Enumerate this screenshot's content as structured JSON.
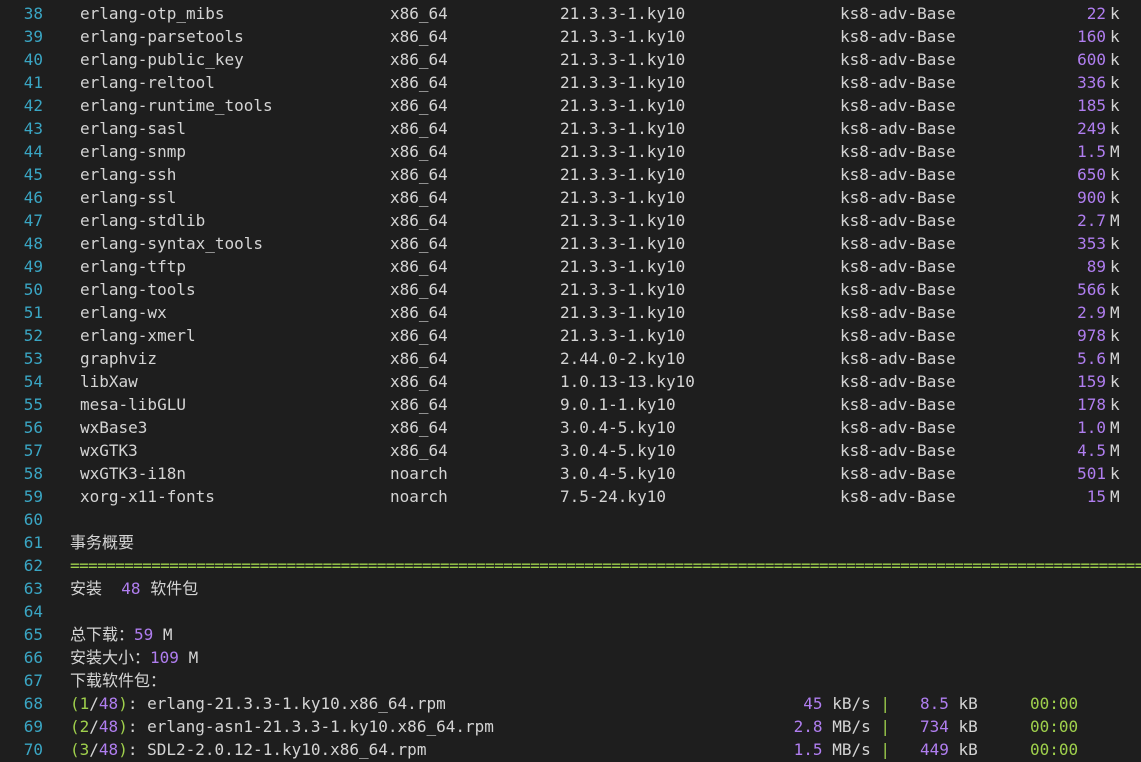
{
  "packages": [
    {
      "line": "38",
      "name": "erlang-otp_mibs",
      "arch": "x86_64",
      "version": "21.3.3-1.ky10",
      "repo": "ks8-adv-Base",
      "size": "22",
      "unit": "k"
    },
    {
      "line": "39",
      "name": "erlang-parsetools",
      "arch": "x86_64",
      "version": "21.3.3-1.ky10",
      "repo": "ks8-adv-Base",
      "size": "160",
      "unit": "k"
    },
    {
      "line": "40",
      "name": "erlang-public_key",
      "arch": "x86_64",
      "version": "21.3.3-1.ky10",
      "repo": "ks8-adv-Base",
      "size": "600",
      "unit": "k"
    },
    {
      "line": "41",
      "name": "erlang-reltool",
      "arch": "x86_64",
      "version": "21.3.3-1.ky10",
      "repo": "ks8-adv-Base",
      "size": "336",
      "unit": "k"
    },
    {
      "line": "42",
      "name": "erlang-runtime_tools",
      "arch": "x86_64",
      "version": "21.3.3-1.ky10",
      "repo": "ks8-adv-Base",
      "size": "185",
      "unit": "k"
    },
    {
      "line": "43",
      "name": "erlang-sasl",
      "arch": "x86_64",
      "version": "21.3.3-1.ky10",
      "repo": "ks8-adv-Base",
      "size": "249",
      "unit": "k"
    },
    {
      "line": "44",
      "name": "erlang-snmp",
      "arch": "x86_64",
      "version": "21.3.3-1.ky10",
      "repo": "ks8-adv-Base",
      "size": "1.5",
      "unit": "M"
    },
    {
      "line": "45",
      "name": "erlang-ssh",
      "arch": "x86_64",
      "version": "21.3.3-1.ky10",
      "repo": "ks8-adv-Base",
      "size": "650",
      "unit": "k"
    },
    {
      "line": "46",
      "name": "erlang-ssl",
      "arch": "x86_64",
      "version": "21.3.3-1.ky10",
      "repo": "ks8-adv-Base",
      "size": "900",
      "unit": "k"
    },
    {
      "line": "47",
      "name": "erlang-stdlib",
      "arch": "x86_64",
      "version": "21.3.3-1.ky10",
      "repo": "ks8-adv-Base",
      "size": "2.7",
      "unit": "M"
    },
    {
      "line": "48",
      "name": "erlang-syntax_tools",
      "arch": "x86_64",
      "version": "21.3.3-1.ky10",
      "repo": "ks8-adv-Base",
      "size": "353",
      "unit": "k"
    },
    {
      "line": "49",
      "name": "erlang-tftp",
      "arch": "x86_64",
      "version": "21.3.3-1.ky10",
      "repo": "ks8-adv-Base",
      "size": "89",
      "unit": "k"
    },
    {
      "line": "50",
      "name": "erlang-tools",
      "arch": "x86_64",
      "version": "21.3.3-1.ky10",
      "repo": "ks8-adv-Base",
      "size": "566",
      "unit": "k"
    },
    {
      "line": "51",
      "name": "erlang-wx",
      "arch": "x86_64",
      "version": "21.3.3-1.ky10",
      "repo": "ks8-adv-Base",
      "size": "2.9",
      "unit": "M"
    },
    {
      "line": "52",
      "name": "erlang-xmerl",
      "arch": "x86_64",
      "version": "21.3.3-1.ky10",
      "repo": "ks8-adv-Base",
      "size": "978",
      "unit": "k"
    },
    {
      "line": "53",
      "name": "graphviz",
      "arch": "x86_64",
      "version": "2.44.0-2.ky10",
      "repo": "ks8-adv-Base",
      "size": "5.6",
      "unit": "M"
    },
    {
      "line": "54",
      "name": "libXaw",
      "arch": "x86_64",
      "version": "1.0.13-13.ky10",
      "repo": "ks8-adv-Base",
      "size": "159",
      "unit": "k"
    },
    {
      "line": "55",
      "name": "mesa-libGLU",
      "arch": "x86_64",
      "version": "9.0.1-1.ky10",
      "repo": "ks8-adv-Base",
      "size": "178",
      "unit": "k"
    },
    {
      "line": "56",
      "name": "wxBase3",
      "arch": "x86_64",
      "version": "3.0.4-5.ky10",
      "repo": "ks8-adv-Base",
      "size": "1.0",
      "unit": "M"
    },
    {
      "line": "57",
      "name": "wxGTK3",
      "arch": "x86_64",
      "version": "3.0.4-5.ky10",
      "repo": "ks8-adv-Base",
      "size": "4.5",
      "unit": "M"
    },
    {
      "line": "58",
      "name": "wxGTK3-i18n",
      "arch": "noarch",
      "version": "3.0.4-5.ky10",
      "repo": "ks8-adv-Base",
      "size": "501",
      "unit": "k"
    },
    {
      "line": "59",
      "name": "xorg-x11-fonts",
      "arch": "noarch",
      "version": "7.5-24.ky10",
      "repo": "ks8-adv-Base",
      "size": "15",
      "unit": "M"
    }
  ],
  "blank1": {
    "line": "60"
  },
  "summary": {
    "line": "61",
    "title": "事务概要"
  },
  "separator": {
    "line": "62",
    "text": "========================================================================================================================"
  },
  "install": {
    "line": "63",
    "prefix": "安装",
    "count": "48",
    "suffix": "软件包"
  },
  "blank2": {
    "line": "64"
  },
  "total_download": {
    "line": "65",
    "label": "总下载：",
    "value": "59",
    "unit": "M"
  },
  "install_size": {
    "line": "66",
    "label": "安装大小：",
    "value": "109",
    "unit": "M"
  },
  "downloading": {
    "line": "67",
    "label": "下载软件包："
  },
  "downloads": [
    {
      "line": "68",
      "index": "1",
      "total": "48",
      "file": "erlang-21.3.3-1.ky10.x86_64.rpm",
      "rate": "45",
      "rate_unit": "kB/s",
      "size": "8.5",
      "size_unit": "kB",
      "time": "00:00"
    },
    {
      "line": "69",
      "index": "2",
      "total": "48",
      "file": "erlang-asn1-21.3.3-1.ky10.x86_64.rpm",
      "rate": "2.8",
      "rate_unit": "MB/s",
      "size": "734",
      "size_unit": "kB",
      "time": "00:00"
    },
    {
      "line": "70",
      "index": "3",
      "total": "48",
      "file": "SDL2-2.0.12-1.ky10.x86_64.rpm",
      "rate": "1.5",
      "rate_unit": "MB/s",
      "size": "449",
      "size_unit": "kB",
      "time": "00:00"
    }
  ],
  "colors": {
    "background": "#1e1e1e",
    "text": "#d4d4d4",
    "line_number": "#3aa6c4",
    "number": "#b07ef0",
    "green": "#9fd04c"
  }
}
